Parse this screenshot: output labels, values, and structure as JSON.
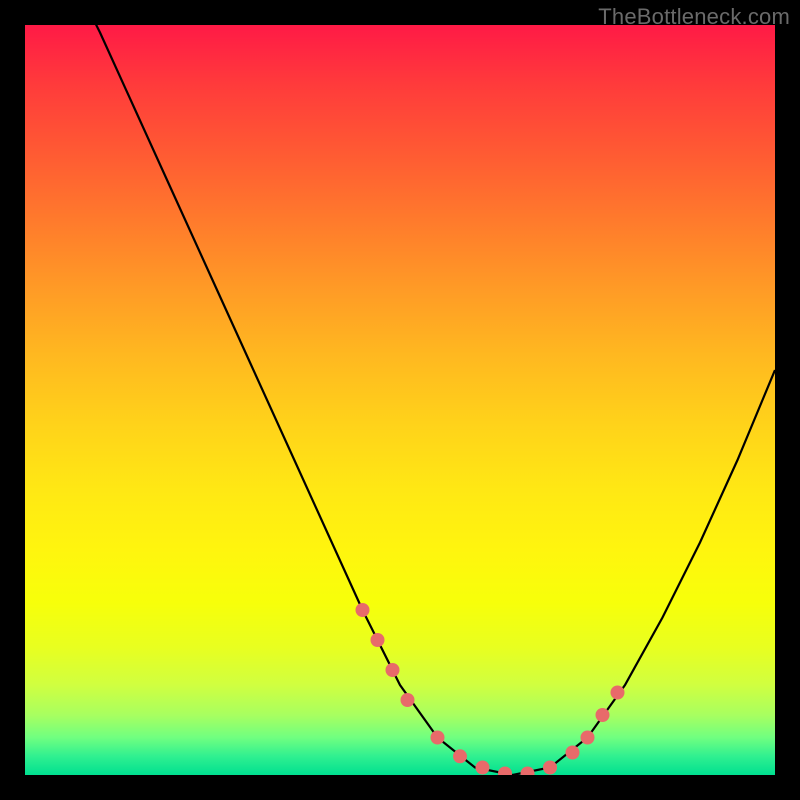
{
  "attribution": "TheBottleneck.com",
  "colors": {
    "frame": "#000000",
    "gradient_top": "#ff1a46",
    "gradient_bottom": "#00e090",
    "curve": "#000000",
    "marker_fill": "#e86a6a",
    "marker_stroke": "#c24a4a"
  },
  "chart_data": {
    "type": "line",
    "title": "",
    "xlabel": "",
    "ylabel": "",
    "xlim": [
      0,
      100
    ],
    "ylim": [
      0,
      100
    ],
    "x": [
      0,
      5,
      10,
      15,
      20,
      25,
      30,
      35,
      40,
      45,
      50,
      55,
      60,
      65,
      70,
      75,
      80,
      85,
      90,
      95,
      100
    ],
    "values": [
      119,
      109,
      99,
      88,
      77,
      66,
      55,
      44,
      33,
      22,
      12,
      5,
      1,
      0,
      1,
      5,
      12,
      21,
      31,
      42,
      54
    ],
    "markers": {
      "x": [
        45,
        47,
        49,
        51,
        55,
        58,
        61,
        64,
        67,
        70,
        73,
        75,
        77,
        79
      ],
      "y": [
        22,
        18,
        14,
        10,
        5,
        2.5,
        1,
        0.2,
        0.2,
        1,
        3,
        5,
        8,
        11
      ]
    }
  }
}
